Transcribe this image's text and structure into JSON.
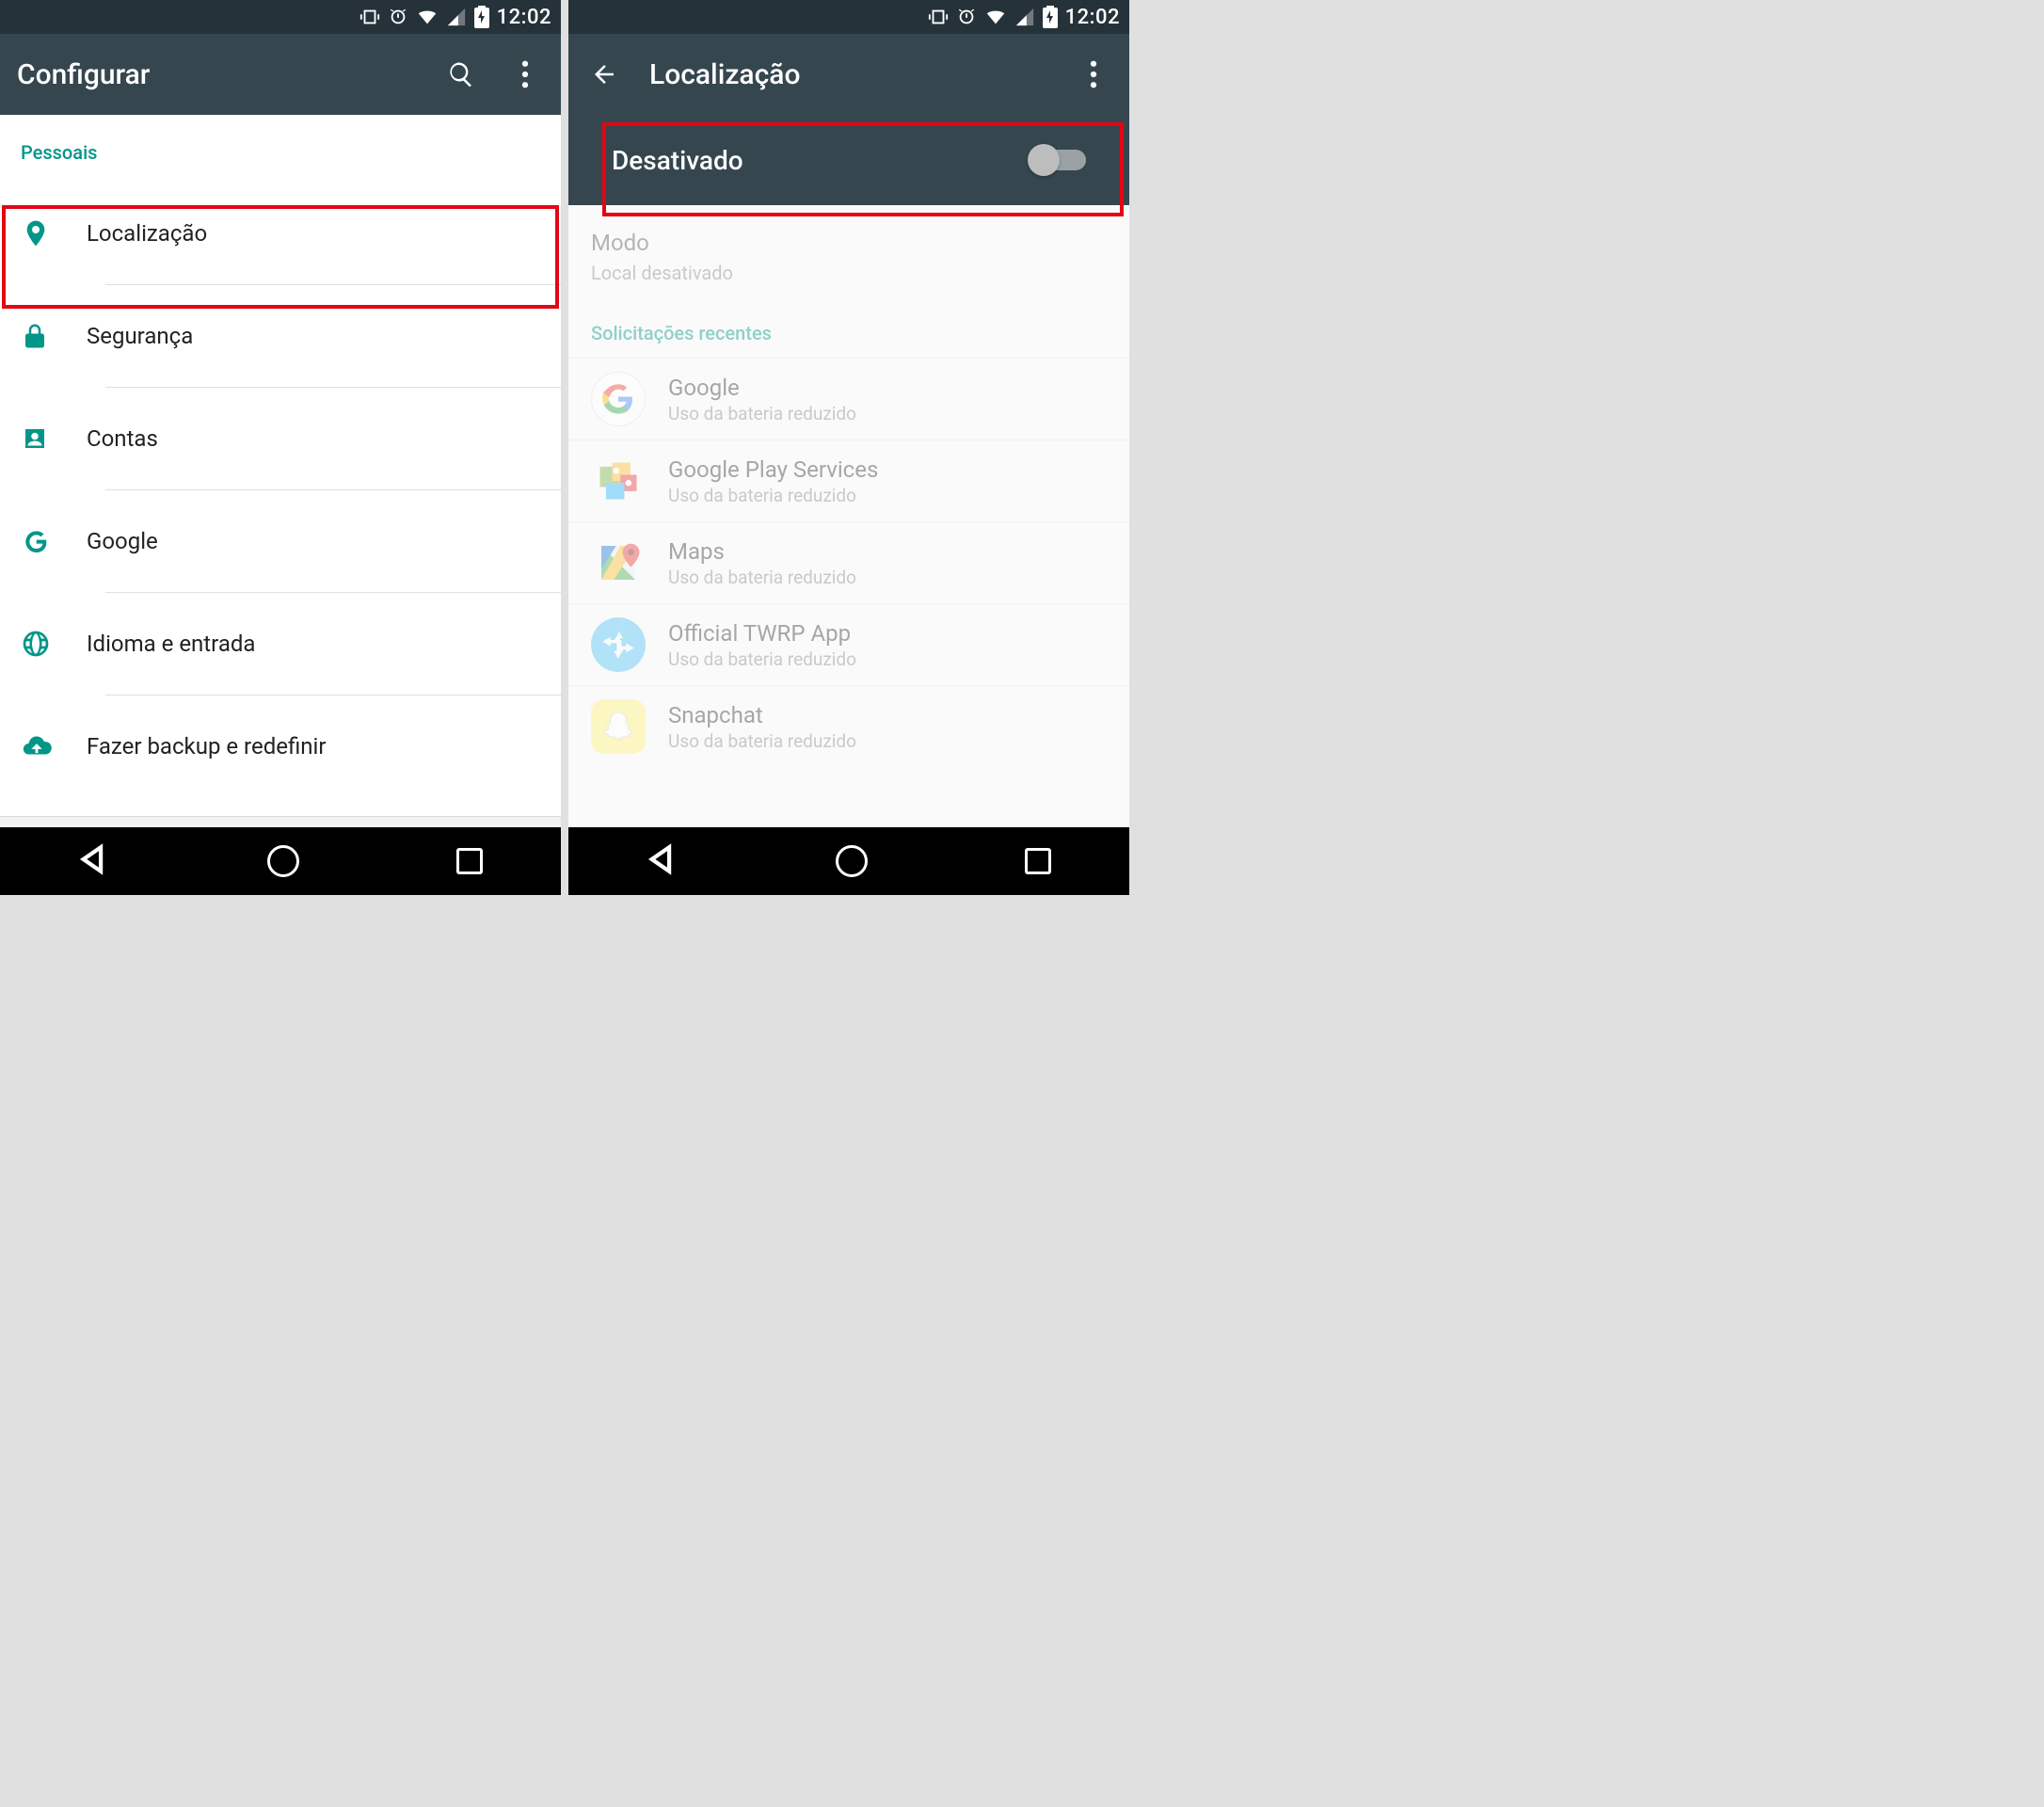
{
  "status": {
    "time": "12:02"
  },
  "left": {
    "title": "Configurar",
    "section": "Pessoais",
    "items": [
      {
        "label": "Localização"
      },
      {
        "label": "Segurança"
      },
      {
        "label": "Contas"
      },
      {
        "label": "Google"
      },
      {
        "label": "Idioma e entrada"
      },
      {
        "label": "Fazer backup e redefinir"
      }
    ]
  },
  "right": {
    "title": "Localização",
    "toggle_label": "Desativado",
    "mode_title": "Modo",
    "mode_sub": "Local desativado",
    "recent_title": "Solicitações recentes",
    "apps": [
      {
        "name": "Google",
        "sub": "Uso da bateria reduzido"
      },
      {
        "name": "Google Play Services",
        "sub": "Uso da bateria reduzido"
      },
      {
        "name": "Maps",
        "sub": "Uso da bateria reduzido"
      },
      {
        "name": "Official TWRP App",
        "sub": "Uso da bateria reduzido"
      },
      {
        "name": "Snapchat",
        "sub": "Uso da bateria reduzido"
      }
    ]
  }
}
